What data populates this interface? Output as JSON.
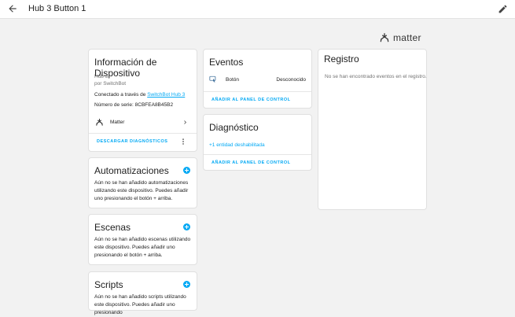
{
  "header": {
    "title": "Hub 3 Button 1"
  },
  "branding": {
    "logo_text": "matter"
  },
  "device_info": {
    "title": "Información de Dispositivo",
    "model": "Hub 3",
    "manufacturer": "por SwitchBot",
    "connected_prefix": "Conectado a través de",
    "connected_link": "SwitchBot Hub 3",
    "serial": "Número de serie: 8CBFEA8B45B2",
    "integration": "Matter",
    "download_label": "DESCARGAR DIAGNÓSTICOS"
  },
  "automations": {
    "title": "Automatizaciones",
    "text": "Aún no se han añadido automatizaciones utilizando este dispositivo. Puedes añadir uno presionando el botón + arriba."
  },
  "scenes": {
    "title": "Escenas",
    "text": "Aún no se han añadido escenas utilizando este dispositivo. Puedes añadir uno presionando el botón + arriba."
  },
  "scripts": {
    "title": "Scripts",
    "text": "Aún no se han añadido scripts utilizando este dispositivo. Puedes añadir uno presionando"
  },
  "events": {
    "title": "Eventos",
    "entity_name": "Botón",
    "entity_state": "Desconocido",
    "add_label": "AÑADIR AL PANEL DE CONTROL"
  },
  "diagnostics": {
    "title": "Diagnóstico",
    "disabled_entities": "+1 entidad deshabilitada",
    "add_label": "AÑADIR AL PANEL DE CONTROL"
  },
  "logbook": {
    "title": "Registro",
    "empty_text": "No se han encontrado eventos en el registro."
  },
  "colors": {
    "accent": "#03a9f4",
    "background": "#f2f2f2",
    "card": "#ffffff"
  },
  "icons": {
    "back": "arrow-left-icon",
    "edit": "pencil-icon",
    "matter": "matter-logo-icon",
    "chevron": "chevron-right-icon",
    "more": "dots-vertical-icon",
    "add": "plus-circle-icon",
    "button_entity": "gesture-tap-button-icon"
  }
}
